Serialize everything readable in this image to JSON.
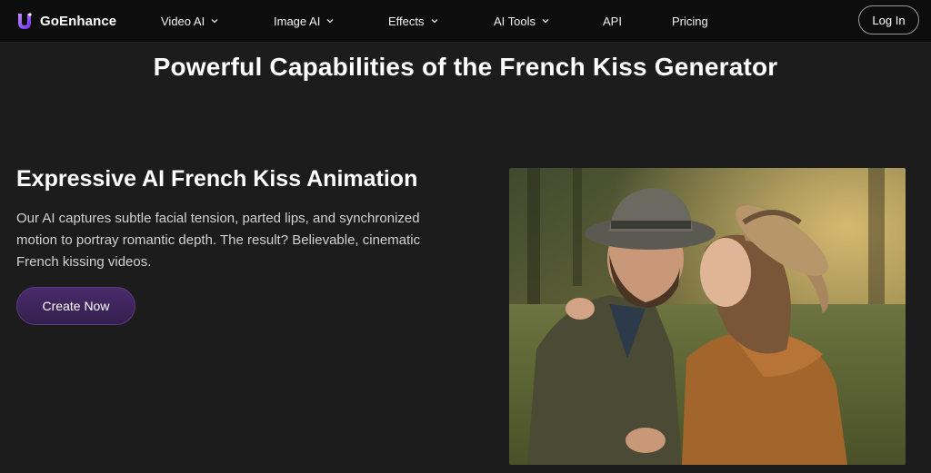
{
  "brand": {
    "name": "GoEnhance",
    "accent": "#8a4dff"
  },
  "nav": {
    "items": [
      {
        "label": "Video AI",
        "has_dropdown": true
      },
      {
        "label": "Image AI",
        "has_dropdown": true
      },
      {
        "label": "Effects",
        "has_dropdown": true
      },
      {
        "label": "AI Tools",
        "has_dropdown": true
      },
      {
        "label": "API",
        "has_dropdown": false
      },
      {
        "label": "Pricing",
        "has_dropdown": false
      }
    ],
    "login_label": "Log In"
  },
  "section": {
    "title": "Powerful Capabilities of the French Kiss Generator"
  },
  "feature": {
    "heading": "Expressive AI French Kiss Animation",
    "description": "Our AI captures subtle facial tension, parted lips, and synchronized motion to portray romantic depth. The result? Believable, cinematic French kissing videos.",
    "cta_label": "Create Now",
    "image_icon": "couple-kissing-photo"
  },
  "colors": {
    "background": "#1c1c1c",
    "navbar": "#0d0d0d",
    "cta": "#3d2659"
  }
}
